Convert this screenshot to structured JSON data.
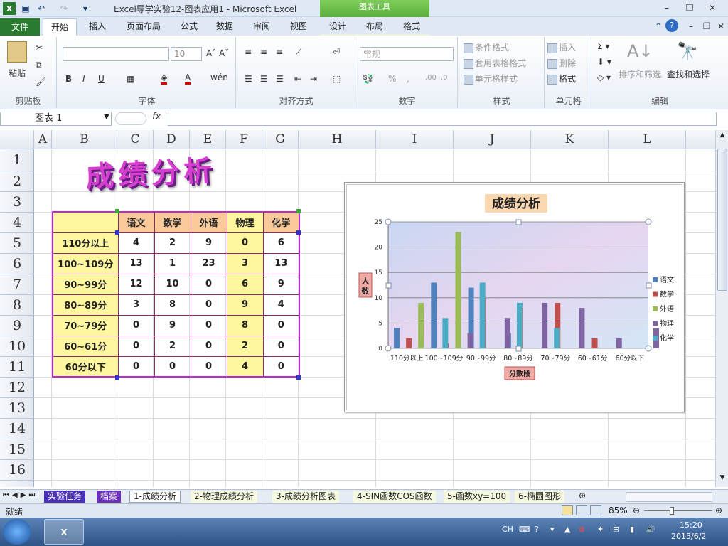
{
  "window": {
    "title": "Excel导学实验12-图表应用1 - Microsoft Excel",
    "context_tab_group": "图表工具"
  },
  "tabs": [
    "文件",
    "开始",
    "插入",
    "页面布局",
    "公式",
    "数据",
    "审阅",
    "视图",
    "设计",
    "布局",
    "格式"
  ],
  "ribbon": {
    "clipboard": {
      "label": "剪贴板",
      "paste": "粘贴"
    },
    "font": {
      "label": "字体",
      "size": "10"
    },
    "align": {
      "label": "对齐方式"
    },
    "number": {
      "label": "数字",
      "format": "常规"
    },
    "styles": {
      "label": "样式",
      "cond": "条件格式",
      "table": "套用表格格式",
      "cell": "单元格样式"
    },
    "cells": {
      "label": "单元格",
      "insert": "插入",
      "delete": "删除",
      "format": "格式"
    },
    "edit": {
      "label": "编辑",
      "sort": "排序和筛选",
      "find": "查找和选择"
    }
  },
  "formula_bar": {
    "name_box": "图表 1",
    "fx": "fx"
  },
  "columns": [
    "A",
    "B",
    "C",
    "D",
    "E",
    "F",
    "G",
    "H",
    "I",
    "J",
    "K",
    "L"
  ],
  "rows": [
    "1",
    "2",
    "3",
    "4",
    "5",
    "6",
    "7",
    "8",
    "9",
    "10",
    "11",
    "12",
    "13",
    "14",
    "15",
    "16"
  ],
  "sheet_title": "成绩分析",
  "table": {
    "headers": [
      "语文",
      "数学",
      "外语",
      "物理",
      "化学"
    ],
    "rows": [
      {
        "label": "110分以上",
        "v": [
          "4",
          "2",
          "9",
          "0",
          "6"
        ]
      },
      {
        "label": "100~109分",
        "v": [
          "13",
          "1",
          "23",
          "3",
          "13"
        ]
      },
      {
        "label": "90~99分",
        "v": [
          "12",
          "10",
          "0",
          "6",
          "9"
        ]
      },
      {
        "label": "80~89分",
        "v": [
          "3",
          "8",
          "0",
          "9",
          "4"
        ]
      },
      {
        "label": "70~79分",
        "v": [
          "0",
          "9",
          "0",
          "8",
          "0"
        ]
      },
      {
        "label": "60~61分",
        "v": [
          "0",
          "2",
          "0",
          "2",
          "0"
        ]
      },
      {
        "label": "60分以下",
        "v": [
          "0",
          "0",
          "0",
          "4",
          "0"
        ]
      }
    ]
  },
  "chart_data": {
    "type": "bar",
    "title": "成绩分析",
    "xlabel": "分数段",
    "ylabel": "人数",
    "ylim": [
      0,
      25
    ],
    "yticks": [
      0,
      5,
      10,
      15,
      20,
      25
    ],
    "categories": [
      "110分以上",
      "100~109分",
      "90~99分",
      "80~89分",
      "70~79分",
      "60~61分",
      "60分以下"
    ],
    "series": [
      {
        "name": "语文",
        "color": "#4f81bd",
        "values": [
          4,
          13,
          12,
          3,
          0,
          0,
          0
        ]
      },
      {
        "name": "数学",
        "color": "#c0504d",
        "values": [
          2,
          1,
          10,
          8,
          9,
          2,
          0
        ]
      },
      {
        "name": "外语",
        "color": "#9bbb59",
        "values": [
          9,
          23,
          0,
          0,
          0,
          0,
          0
        ]
      },
      {
        "name": "物理",
        "color": "#8064a2",
        "values": [
          0,
          3,
          6,
          9,
          8,
          2,
          4
        ]
      },
      {
        "name": "化学",
        "color": "#4bacc6",
        "values": [
          6,
          13,
          9,
          4,
          0,
          0,
          0
        ]
      }
    ],
    "legend": "right",
    "grid": true
  },
  "sheet_tabs": [
    "实验任务",
    "档案",
    "1-成绩分析",
    "2-物理成绩分析",
    "3-成绩分析图表",
    "4-SIN函数COS函数",
    "5-函数xy=100",
    "6-椭圆图形"
  ],
  "status": {
    "ready": "就绪",
    "zoom": "85%"
  },
  "taskbar": {
    "lang": "CH",
    "time": "15:20",
    "date": "2015/6/2"
  }
}
